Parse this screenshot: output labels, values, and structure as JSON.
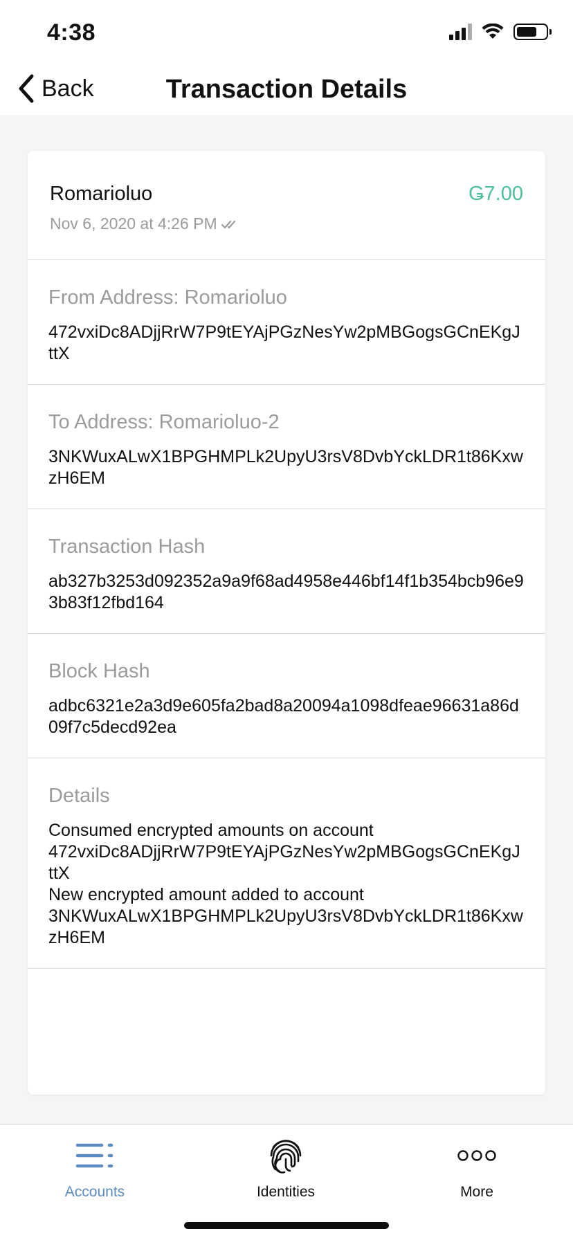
{
  "status_bar": {
    "time": "4:38"
  },
  "nav": {
    "back_label": "Back",
    "title": "Transaction Details"
  },
  "transaction": {
    "name": "Romarioluo",
    "amount": "Ǥ7.00",
    "amount_color": "#4cbf9c",
    "timestamp": "Nov 6, 2020 at 4:26 PM"
  },
  "sections": {
    "from": {
      "label": "From Address: Romarioluo",
      "value": "472vxiDc8ADjjRrW7P9tEYAjPGzNesYw2pMBGogsGCnEKgJttX"
    },
    "to": {
      "label": "To Address: Romarioluo-2",
      "value": "3NKWuxALwX1BPGHMPLk2UpyU3rsV8DvbYckLDR1t86KxwzH6EM"
    },
    "tx_hash": {
      "label": "Transaction Hash",
      "value": "ab327b3253d092352a9a9f68ad4958e446bf14f1b354bcb96e93b83f12fbd164"
    },
    "block_hash": {
      "label": "Block Hash",
      "value": "adbc6321e2a3d9e605fa2bad8a20094a1098dfeae96631a86d09f7c5decd92ea"
    },
    "details": {
      "label": "Details",
      "line1": "Consumed encrypted amounts on account",
      "line2": "472vxiDc8ADjjRrW7P9tEYAjPGzNesYw2pMBGogsGCnEKgJttX",
      "line3": "New encrypted amount added to account",
      "line4": "3NKWuxALwX1BPGHMPLk2UpyU3rsV8DvbYckLDR1t86KxwzH6EM"
    }
  },
  "tabs": [
    {
      "label": "Accounts",
      "icon": "accounts-icon",
      "active": true
    },
    {
      "label": "Identities",
      "icon": "fingerprint-icon",
      "active": false
    },
    {
      "label": "More",
      "icon": "more-dots-icon",
      "active": false
    }
  ],
  "colors": {
    "accent": "#5b8bc0",
    "positive": "#4cbf9c",
    "muted": "#9b9b9b"
  }
}
